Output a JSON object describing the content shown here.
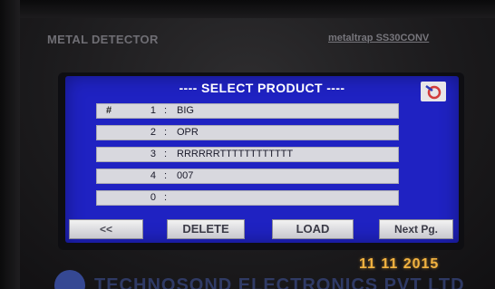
{
  "device": {
    "brand": "METAL DETECTOR",
    "model": "metaltrap SS30CONV",
    "company": "TECHNOSOND ELECTRONICS PVT LTD"
  },
  "screen": {
    "title": "---- SELECT PRODUCT ----",
    "rows": [
      {
        "marker": "#",
        "number": "1",
        "name": "BIG"
      },
      {
        "marker": "",
        "number": "2",
        "name": "OPR"
      },
      {
        "marker": "",
        "number": "3",
        "name": "RRRRRRTTTTTTTTTTTT"
      },
      {
        "marker": "",
        "number": "4",
        "name": "007"
      },
      {
        "marker": "",
        "number": "0",
        "name": ""
      }
    ],
    "separator": ":",
    "buttons": {
      "back": "<<",
      "delete": "DELETE",
      "load": "LOAD",
      "next": "Next Pg."
    }
  },
  "date": "11 11 2015",
  "colors": {
    "lcd_background": "#1f22c2",
    "row_background": "#d8d8de",
    "date_color": "#f2b340"
  },
  "icons": {
    "screen_logo": "logo-icon",
    "company_logo": "company-logo-icon"
  }
}
